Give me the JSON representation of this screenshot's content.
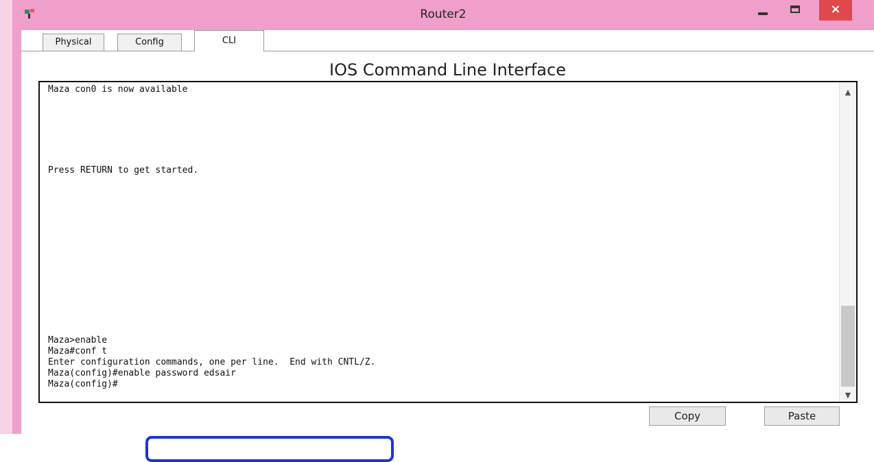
{
  "window": {
    "title": "Router2",
    "close_label": "×",
    "icon": "router-icon"
  },
  "tabs": [
    {
      "label": "Physical"
    },
    {
      "label": "Config"
    },
    {
      "label": "CLI"
    }
  ],
  "cli": {
    "heading": "IOS Command Line Interface",
    "lines": [
      "Maza con0 is now available",
      "Press RETURN to get started.",
      "Maza>enable",
      "Maza#conf t",
      "Enter configuration commands, one per line.  End with CNTL/Z.",
      "Maza(config)#enable password edsair",
      "Maza(config)#"
    ]
  },
  "buttons": {
    "copy": "Copy",
    "paste": "Paste"
  },
  "colors": {
    "titlebar": "#ef9fc9",
    "close": "#e0484d",
    "highlight": "#1f33d6"
  }
}
